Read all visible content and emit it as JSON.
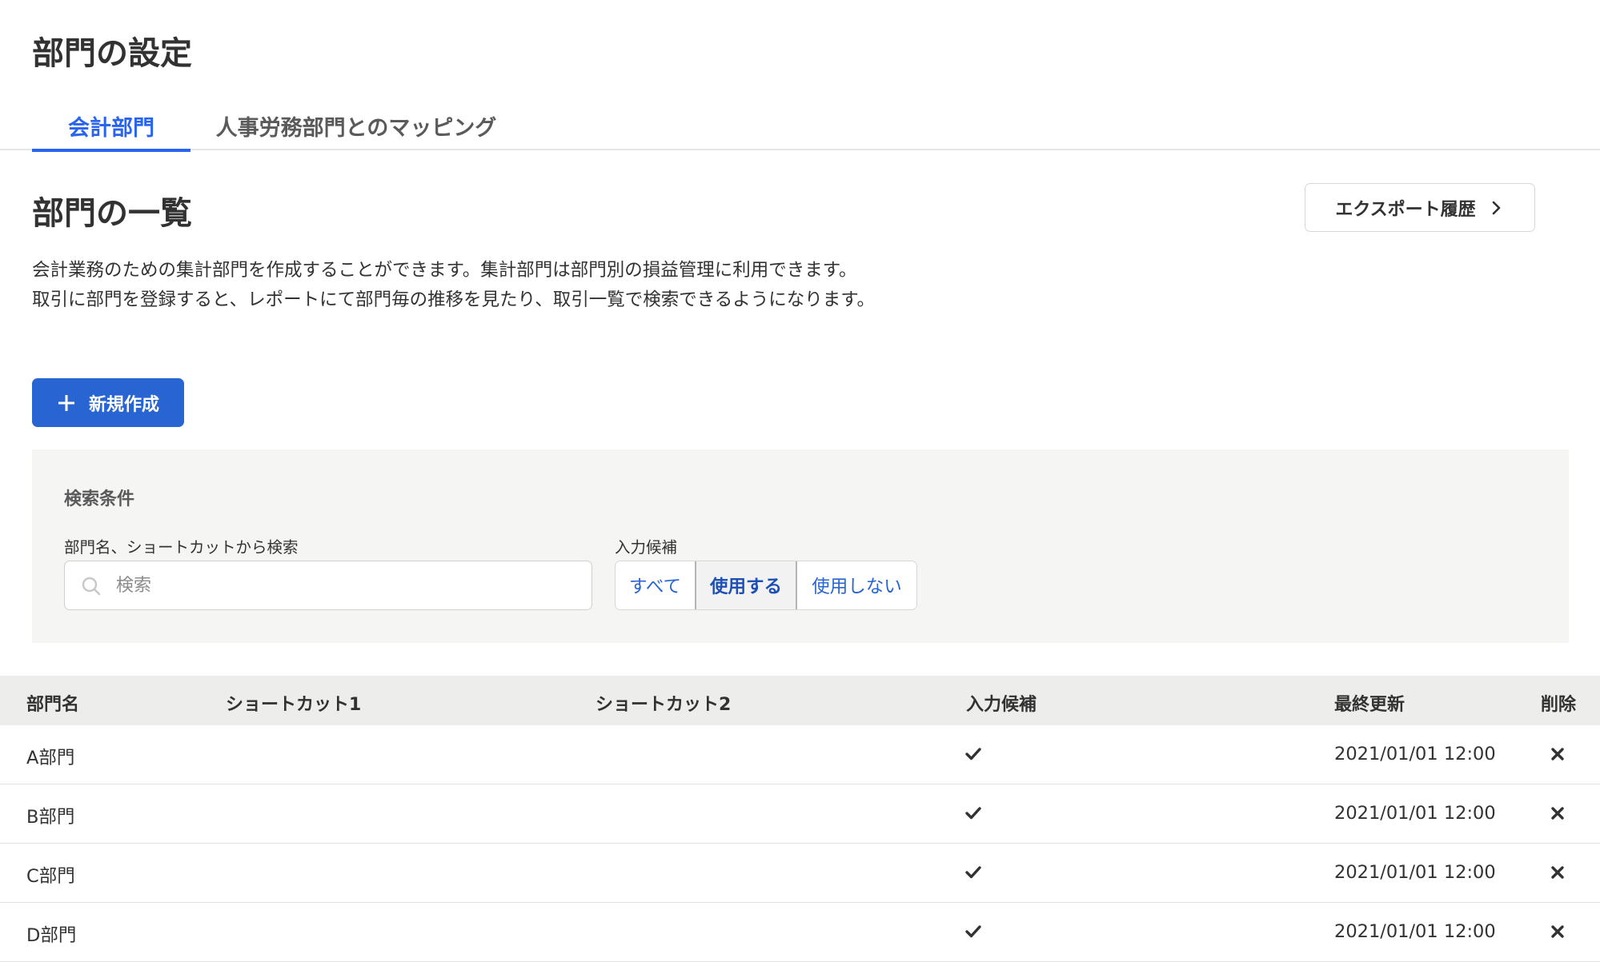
{
  "page": {
    "title": "部門の設定"
  },
  "tabs": [
    {
      "label": "会計部門",
      "active": true
    },
    {
      "label": "人事労務部門とのマッピング",
      "active": false
    }
  ],
  "section": {
    "title": "部門の一覧",
    "export_label": "エクスポート履歴",
    "description_line1": "会計業務のための集計部門を作成することができます。集計部門は部門別の損益管理に利用できます。",
    "description_line2": "取引に部門を登録すると、レポートにて部門毎の推移を見たり、取引一覧で検索できるようになります。",
    "new_label": "新規作成"
  },
  "search": {
    "panel_title": "検索条件",
    "search_label": "部門名、ショートカットから検索",
    "search_placeholder": "検索",
    "search_value": "",
    "candidate_label": "入力候補",
    "options": [
      {
        "label": "すべて",
        "selected": false
      },
      {
        "label": "使用する",
        "selected": true
      },
      {
        "label": "使用しない",
        "selected": false
      }
    ]
  },
  "table": {
    "columns": {
      "name": "部門名",
      "shortcut1": "ショートカット1",
      "shortcut2": "ショートカット2",
      "candidate": "入力候補",
      "updated": "最終更新",
      "delete": "削除"
    },
    "rows": [
      {
        "name": "A部門",
        "shortcut1": "",
        "shortcut2": "",
        "candidate": true,
        "updated": "2021/01/01 12:00"
      },
      {
        "name": "B部門",
        "shortcut1": "",
        "shortcut2": "",
        "candidate": true,
        "updated": "2021/01/01 12:00"
      },
      {
        "name": "C部門",
        "shortcut1": "",
        "shortcut2": "",
        "candidate": true,
        "updated": "2021/01/01 12:00"
      },
      {
        "name": "D部門",
        "shortcut1": "",
        "shortcut2": "",
        "candidate": true,
        "updated": "2021/01/01 12:00"
      }
    ]
  },
  "icons": {
    "search": "search-icon",
    "plus": "plus-icon",
    "chevron": "chevron-right-icon",
    "check": "check-icon",
    "delete": "close-icon"
  },
  "colors": {
    "accent": "#2864f0",
    "primary_button": "#2864d2",
    "panel_bg": "#f5f5f4",
    "table_header_bg": "#ededeb"
  }
}
